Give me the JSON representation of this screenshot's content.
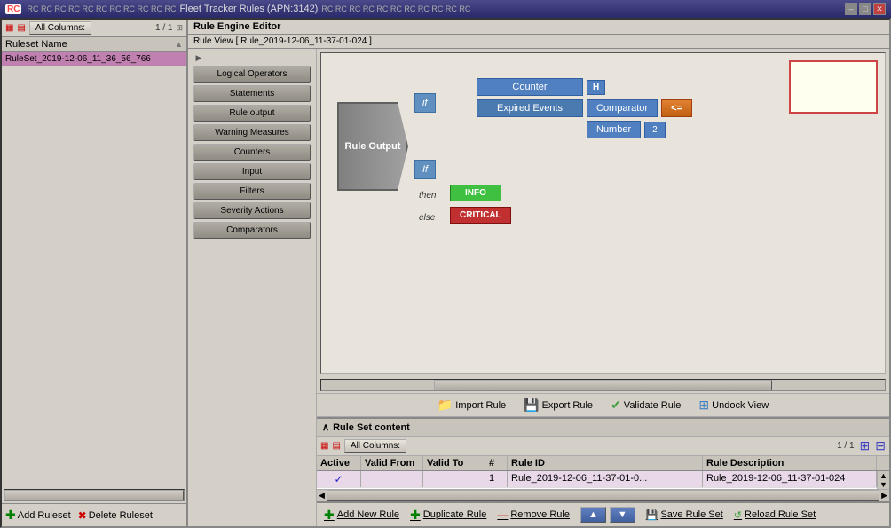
{
  "titlebar": {
    "title": "Fleet Tracker Rules (APN:3142)",
    "min": "–",
    "max": "□",
    "close": "✕"
  },
  "left_panel": {
    "all_columns_label": "All Columns:",
    "pagination": "1 / 1",
    "ruleset_name_col": "Ruleset Name",
    "ruleset_row": "RuleSet_2019-12-06_11_36_56_766",
    "add_ruleset": "Add Ruleset",
    "delete_ruleset": "Delete Ruleset"
  },
  "rule_engine": {
    "header": "Rule Engine Editor",
    "rule_view": "Rule View [ Rule_2019-12-06_11-37-01-024 ]"
  },
  "sidebar_buttons": [
    "Logical Operators",
    "Statements",
    "Rule output",
    "Warning Measures",
    "Counters",
    "Input",
    "Filters",
    "Severity Actions",
    "Comparators"
  ],
  "canvas": {
    "rule_output_label": "Rule Output",
    "if_label": "if",
    "if2_label": "If",
    "counter_label": "Counter",
    "expired_events_label": "Expired Events",
    "comparator_label": "Comparator",
    "number_label": "Number",
    "h_btn": "H",
    "comparator_symbol": "<=",
    "number_value": "2",
    "then_label": "then",
    "else_label": "else",
    "info_label": "INFO",
    "critical_label": "CRITICAL"
  },
  "toolbar": {
    "import_rule": "Import Rule",
    "export_rule": "Export Rule",
    "validate_rule": "Validate Rule",
    "undock_view": "Undock View"
  },
  "ruleset_content": {
    "header": "Rule Set content",
    "all_columns_label": "All Columns:",
    "pagination": "1 / 1",
    "columns": [
      "Active",
      "Valid From",
      "Valid To",
      "#",
      "Rule ID",
      "Rule Description"
    ],
    "rows": [
      {
        "active": "✓",
        "valid_from": "",
        "valid_to": "",
        "num": "1",
        "rule_id": "Rule_2019-12-06_11-37-01-0...",
        "rule_desc": "Rule_2019-12-06_11-37-01-024"
      }
    ]
  },
  "bottom_toolbar": {
    "add_new_rule": "Add New Rule",
    "duplicate_rule": "Duplicate Rule",
    "remove_rule": "Remove Rule",
    "save_rule_set": "Save Rule Set",
    "reload_rule_set": "Reload Rule Set"
  }
}
